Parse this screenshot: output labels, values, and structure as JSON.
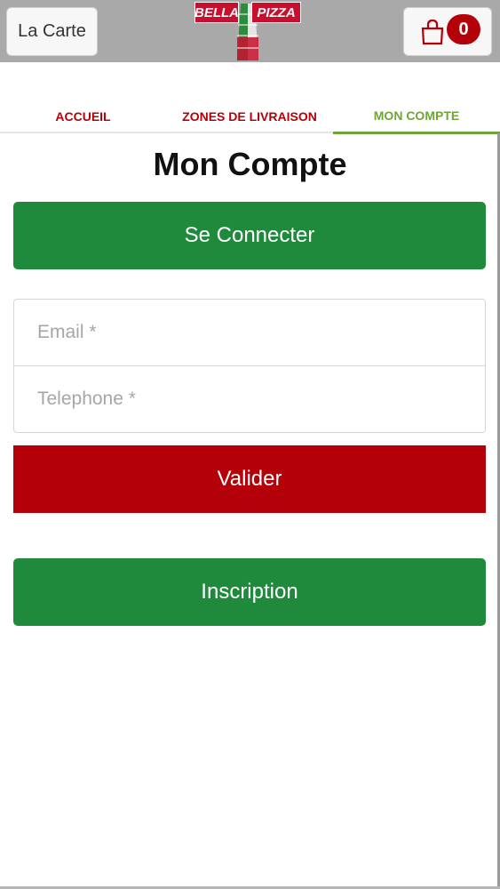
{
  "header": {
    "menu_label": "La Carte",
    "cart_count": "0",
    "logo_left": "BELLA",
    "logo_right": "PIZZA"
  },
  "tabs": [
    {
      "label": "ACCUEIL"
    },
    {
      "label": "ZONES DE LIVRAISON"
    },
    {
      "label": "MON COMPTE"
    }
  ],
  "page": {
    "title": "Mon Compte",
    "login_label": "Se Connecter",
    "email_placeholder": "Email *",
    "phone_placeholder": "Telephone *",
    "submit_label": "Valider",
    "register_label": "Inscription"
  },
  "colors": {
    "accent_green": "#1f8a3b",
    "accent_red": "#b30009",
    "active_tab": "#6fa537",
    "header_bg": "#a9a9a9"
  }
}
